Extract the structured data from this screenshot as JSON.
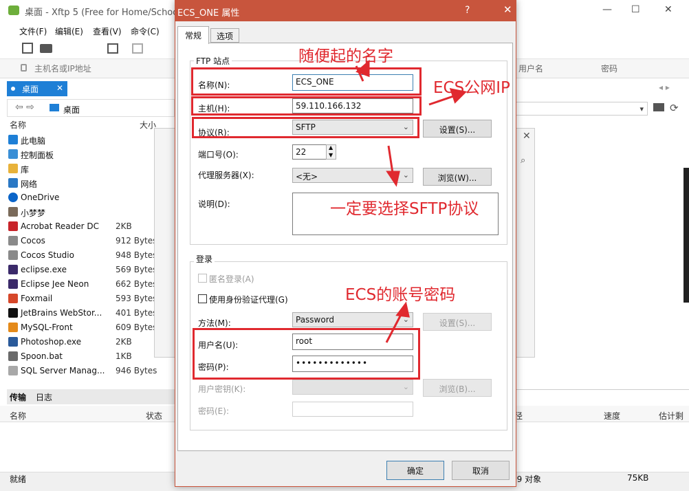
{
  "background_window": {
    "title": "桌面 - Xftp 5 (Free for Home/School)",
    "window_controls": {
      "minimize": "—",
      "maximize": "☐",
      "close": "✕"
    },
    "menu": [
      "文件(F)",
      "编辑(E)",
      "查看(V)",
      "命令(C)"
    ],
    "address_placeholder": "主机名或IP地址",
    "right_columns": {
      "username": "用户名",
      "password": "密码"
    },
    "local_tab": "桌面",
    "local_path": "桌面",
    "file_columns": {
      "name": "名称",
      "size": "大小"
    },
    "files": [
      {
        "name": "此电脑",
        "size": ""
      },
      {
        "name": "控制面板",
        "size": ""
      },
      {
        "name": "库",
        "size": ""
      },
      {
        "name": "网络",
        "size": ""
      },
      {
        "name": "OneDrive",
        "size": ""
      },
      {
        "name": "小梦梦",
        "size": ""
      },
      {
        "name": "Acrobat Reader DC",
        "size": "2KB"
      },
      {
        "name": "Cocos",
        "size": "912 Bytes"
      },
      {
        "name": "Cocos Studio",
        "size": "948 Bytes"
      },
      {
        "name": "eclipse.exe",
        "size": "569 Bytes"
      },
      {
        "name": "Eclipse Jee Neon",
        "size": "662 Bytes"
      },
      {
        "name": "Foxmail",
        "size": "593 Bytes"
      },
      {
        "name": "JetBrains WebStor...",
        "size": "401 Bytes"
      },
      {
        "name": "MySQL-Front",
        "size": "609 Bytes"
      },
      {
        "name": "Photoshop.exe",
        "size": "2KB"
      },
      {
        "name": "Spoon.bat",
        "size": "1KB"
      },
      {
        "name": "SQL Server Manag...",
        "size": "946 Bytes"
      }
    ],
    "bottom_tabs": [
      "传输",
      "日志"
    ],
    "bottom_columns": {
      "name": "名称",
      "status": "状态",
      "path": "径",
      "speed": "速度",
      "eta": "估计剩"
    },
    "status_ready": "就绪",
    "status_objects": "29 对象",
    "status_size": "75KB"
  },
  "dialog": {
    "title": "ECS_ONE 属性",
    "help": "?",
    "close": "✕",
    "tabs": {
      "general": "常规",
      "options": "选项"
    },
    "ftp_group": {
      "title": "FTP 站点",
      "name_label": "名称(N):",
      "name_value": "ECS_ONE",
      "host_label": "主机(H):",
      "host_value": "59.110.166.132",
      "protocol_label": "协议(R):",
      "protocol_value": "SFTP",
      "settings_button": "设置(S)...",
      "port_label": "端口号(O):",
      "port_value": "22",
      "proxy_label": "代理服务器(X):",
      "proxy_value": "<无>",
      "browse_button": "浏览(W)...",
      "desc_label": "说明(D):",
      "desc_value": ""
    },
    "login_group": {
      "title": "登录",
      "anonymous_label": "匿名登录(A)",
      "identity_agent_label": "使用身份验证代理(G)",
      "method_label": "方法(M):",
      "method_value": "Password",
      "method_settings_button": "设置(S)...",
      "username_label": "用户名(U):",
      "username_value": "root",
      "password_label": "密码(P):",
      "password_value": "•••••••••••••",
      "userkey_label": "用户密钥(K):",
      "userkey_value": "",
      "userkey_browse_button": "浏览(B)...",
      "passphrase_label": "密码(E):",
      "passphrase_value": ""
    },
    "ok_button": "确定",
    "cancel_button": "取消"
  },
  "annotations": {
    "name_note": "随便起的名字",
    "host_note": "ECS公网IP",
    "protocol_note": "一定要选择SFTP协议",
    "account_note": "ECS的账号密码"
  },
  "colors": {
    "dialog_title_bar": "#c8553d",
    "annotation_red": "#e0292f",
    "tab_blue": "#1e7fd6"
  }
}
